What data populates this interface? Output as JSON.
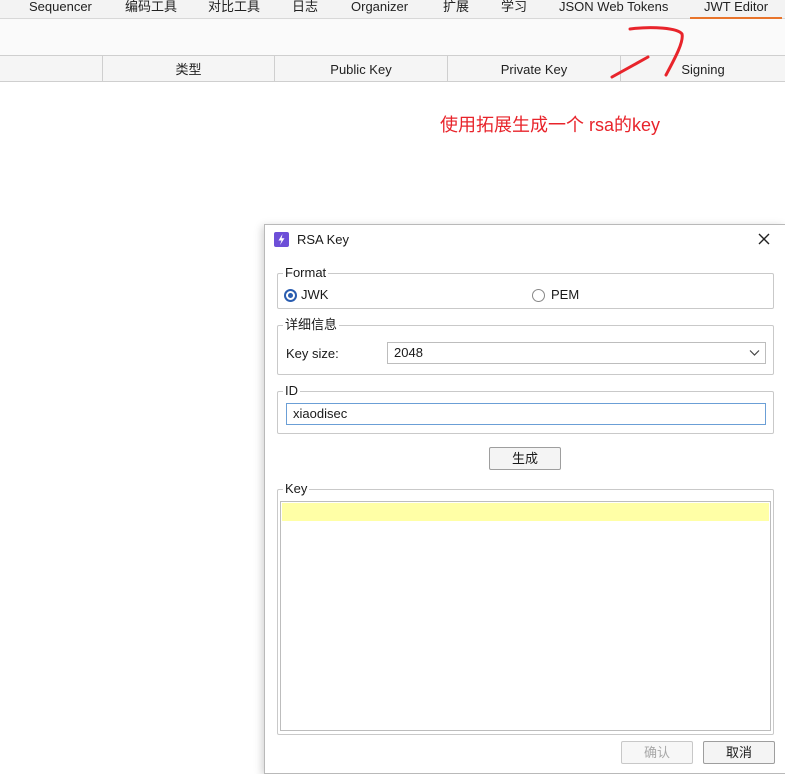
{
  "tabs": [
    {
      "label": "Sequencer"
    },
    {
      "label": "编码工具"
    },
    {
      "label": "对比工具"
    },
    {
      "label": "日志"
    },
    {
      "label": "Organizer"
    },
    {
      "label": "扩展"
    },
    {
      "label": "学习"
    },
    {
      "label": "JSON Web Tokens"
    },
    {
      "label": "JWT Editor",
      "active": true
    }
  ],
  "table": {
    "columns": [
      "类型",
      "Public Key",
      "Private Key",
      "Signing"
    ]
  },
  "annotation": {
    "text": "使用拓展生成一个 rsa的key",
    "color": "#e8242b"
  },
  "dialog": {
    "title": "RSA Key",
    "format": {
      "legend": "Format",
      "options": [
        "JWK",
        "PEM"
      ],
      "selected": "JWK"
    },
    "details": {
      "legend": "详细信息",
      "key_size_label": "Key size:",
      "key_size_value": "2048"
    },
    "id": {
      "legend": "ID",
      "value": "xiaodisec"
    },
    "generate_label": "生成",
    "key": {
      "legend": "Key",
      "value": ""
    },
    "ok_label": "确认",
    "cancel_label": "取消"
  },
  "colors": {
    "accent_tab_underline": "#e8742b",
    "dialog_icon": "#6d4fd8",
    "radio_selected": "#2a5db0",
    "key_highlight": "#ffffa6"
  }
}
